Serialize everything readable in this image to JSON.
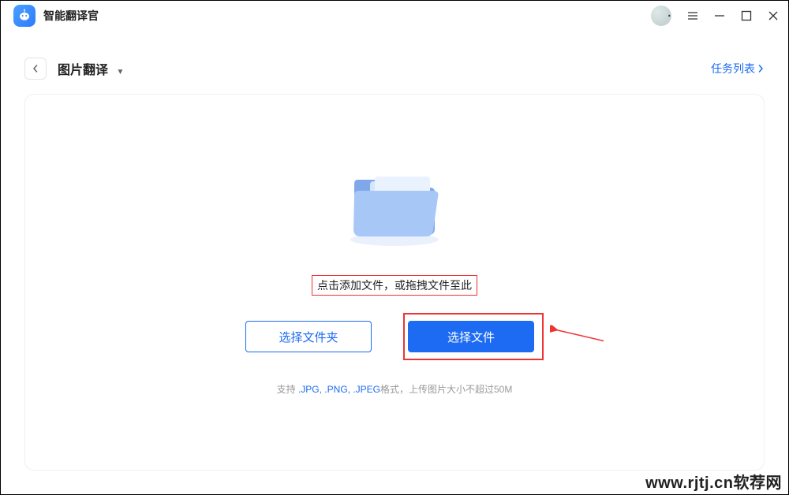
{
  "app": {
    "title": "智能翻译官"
  },
  "header": {
    "page_title": "图片翻译",
    "task_list": "任务列表"
  },
  "drop": {
    "instruction": "点击添加文件，或拖拽文件至此",
    "select_folder": "选择文件夹",
    "select_file": "选择文件",
    "hint_prefix": "支持 ",
    "hint_formats": ".JPG, .PNG, .JPEG",
    "hint_suffix": "格式，上传图片大小不超过50M"
  },
  "watermark": "www.rjtj.cn软荐网"
}
